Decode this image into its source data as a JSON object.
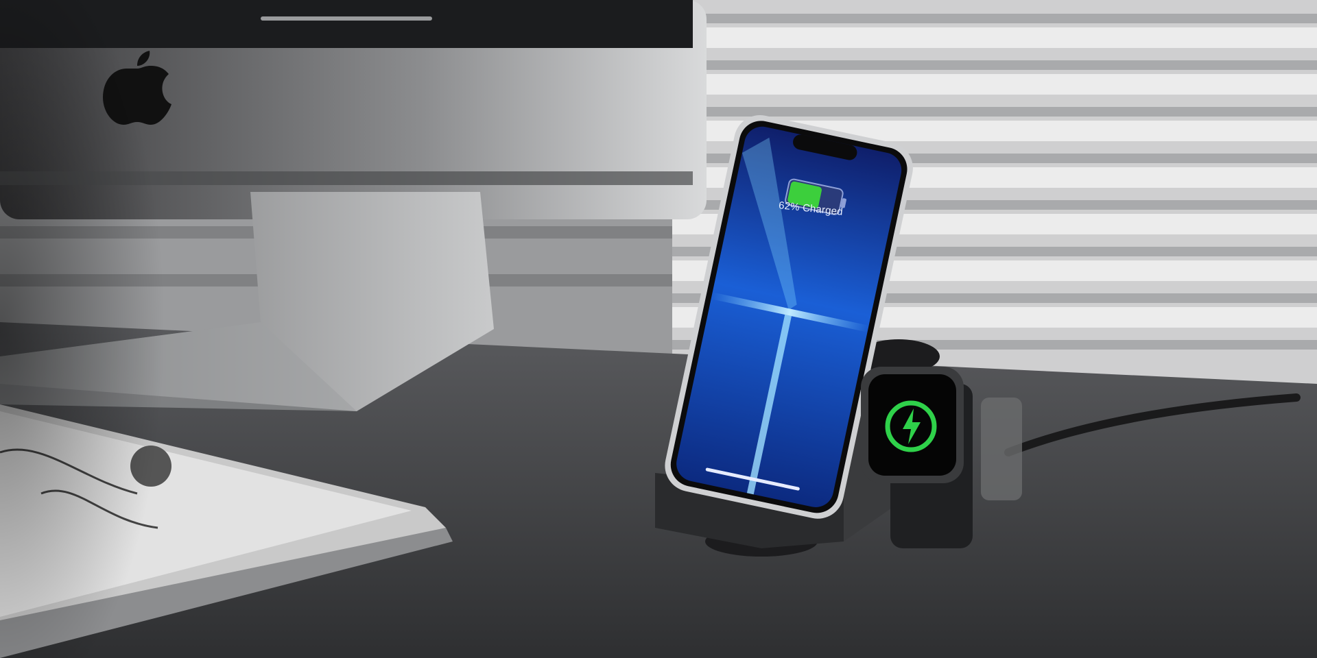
{
  "scene": {
    "phone_screen": {
      "battery_percent": 62,
      "battery_status_text": "62% Charged"
    },
    "watch_screen": {
      "icon": "charging-bolt-icon"
    },
    "colors": {
      "battery_green": "#3ccf3c",
      "screen_blue": "#1a5fd6",
      "screen_glow": "#7fd4ff",
      "desk": "#3e3f41",
      "blinds": "#d8d8d8"
    }
  }
}
